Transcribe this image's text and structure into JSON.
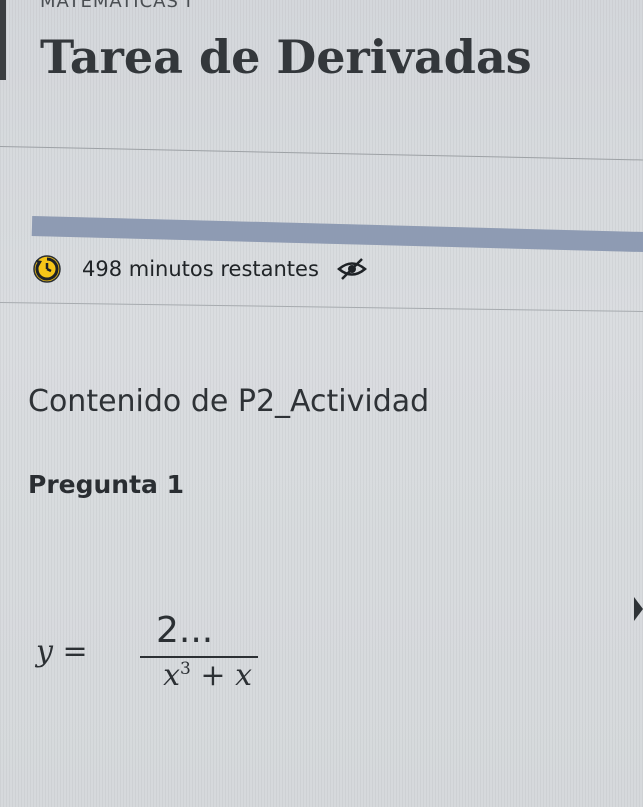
{
  "header": {
    "course_label": "MATEMÁTICAS I",
    "title": "Tarea de Derivadas"
  },
  "timer": {
    "text": "498 minutos restantes",
    "icon": "timer-icon",
    "toggle_icon": "eye-slash-icon",
    "progress_fraction": 0.97
  },
  "content": {
    "title": "Contenido de P2_Actividad"
  },
  "question": {
    "label": "Pregunta 1",
    "formula": {
      "lhs": "y =",
      "numerator": "2...",
      "denominator_base": "x",
      "denominator_exponent": "3",
      "denominator_rest": " + x"
    }
  },
  "colors": {
    "background": "#d9dcdf",
    "progress_fill": "#8e9bb3",
    "text": "#2b2f33"
  }
}
